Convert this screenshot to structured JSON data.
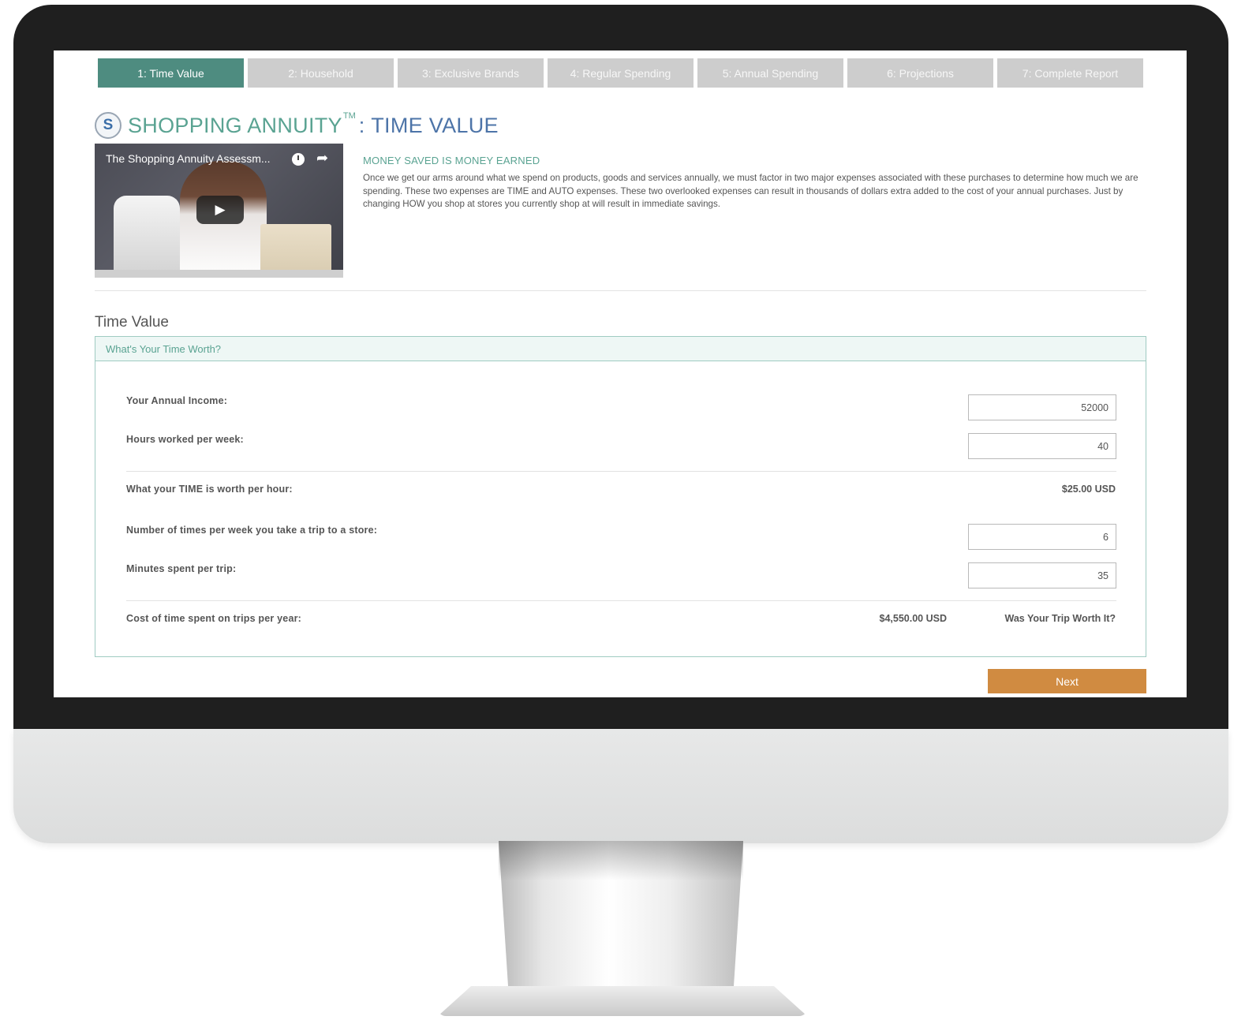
{
  "tabs": [
    {
      "label": "1: Time Value",
      "active": true
    },
    {
      "label": "2: Household",
      "active": false
    },
    {
      "label": "3: Exclusive Brands",
      "active": false
    },
    {
      "label": "4: Regular Spending",
      "active": false
    },
    {
      "label": "5: Annual Spending",
      "active": false
    },
    {
      "label": "6: Projections",
      "active": false
    },
    {
      "label": "7: Complete Report",
      "active": false
    }
  ],
  "header": {
    "logo_letter": "S",
    "title": "SHOPPING ANNUITY",
    "trademark": "TM",
    "separator": ":",
    "subtitle": "TIME VALUE"
  },
  "video": {
    "title": "The Shopping Annuity Assessm...",
    "icons": [
      "clock-icon",
      "share-icon",
      "play-icon"
    ]
  },
  "intro": {
    "heading": "MONEY SAVED IS MONEY EARNED",
    "text": "Once we get our arms around what we spend on products, goods and services annually, we must factor in two major expenses associated with these purchases to determine how much we are spending. These two expenses are TIME and AUTO expenses. These two overlooked expenses can result in thousands of dollars extra added to the cost of your annual purchases. Just by changing HOW you shop at stores you currently shop at will result in immediate savings."
  },
  "section": {
    "title": "Time Value",
    "panel_heading": "What's Your Time Worth?"
  },
  "form": {
    "annual_income": {
      "label": "Your Annual Income:",
      "value": "52000"
    },
    "hours_per_week": {
      "label": "Hours worked per week:",
      "value": "40"
    },
    "time_worth": {
      "label": "What your TIME is worth per hour:",
      "value": "$25.00 USD"
    },
    "trips_per_week": {
      "label": "Number of times per week you take a trip to a store:",
      "value": "6"
    },
    "minutes_per_trip": {
      "label": "Minutes spent per trip:",
      "value": "35"
    },
    "cost_per_year": {
      "label": "Cost of time spent on trips per year:",
      "value": "$4,550.00 USD",
      "note": "Was Your Trip Worth It?"
    }
  },
  "actions": {
    "next_label": "Next"
  },
  "colors": {
    "active_tab": "#4e8c80",
    "inactive_tab": "#cdcdcd",
    "accent_green": "#5aa392",
    "accent_blue": "#4d74a8",
    "next_button": "#d08b41"
  }
}
